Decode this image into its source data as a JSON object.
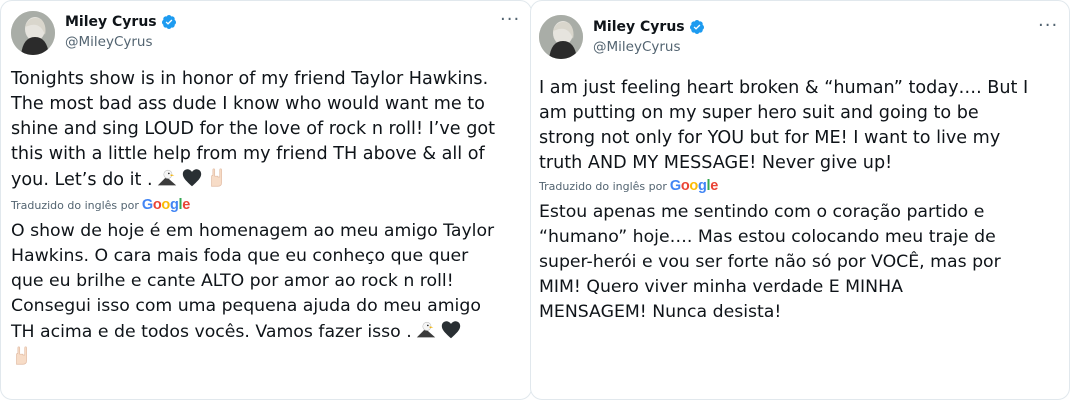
{
  "tweets": [
    {
      "author_name": "Miley Cyrus",
      "author_handle": "@MileyCyrus",
      "more_label": "···",
      "text_en": "Tonights show is in honor of my friend Taylor Hawkins.\nThe most bad ass dude I know who would want me to\nshine and sing LOUD for the love of rock n roll! I’ve got\nthis with a little help from my friend TH above & all of\nyou. Let’s do it .",
      "translated_label": "Traduzido do inglês por",
      "google_label": "Google",
      "text_pt": "O show de hoje é em homenagem ao meu amigo Taylor\nHawkins. O cara mais foda que eu conheço que quer\nque eu brilhe e cante ALTO por amor ao rock n roll!\nConsegui isso com uma pequena ajuda do meu amigo\nTH acima e de todos vocês. Vamos fazer isso ."
    },
    {
      "author_name": "Miley Cyrus",
      "author_handle": "@MileyCyrus",
      "more_label": "···",
      "text_en": "I am just feeling heart broken & “human” today…. But I\nam putting on my super hero suit and going to be\nstrong not only for YOU but for ME! I want to live my\ntruth AND MY MESSAGE! Never give up!",
      "translated_label": "Traduzido do inglês por",
      "google_label": "Google",
      "text_pt": "Estou apenas me sentindo com o coração partido e\n“humano” hoje…. Mas estou colocando meu traje de\nsuper-herói e vou ser forte não só por VOCÊ, mas por\nMIM! Quero viver minha verdade E MINHA\nMENSAGEM! Nunca desista!"
    }
  ],
  "colors": {
    "verified": "#1d9bf0",
    "secondary_text": "#536471",
    "text": "#0f1419"
  },
  "icons": [
    "verified-badge-icon",
    "eagle-emoji-icon",
    "black-heart-emoji-icon",
    "rock-hand-emoji-icon",
    "more-options-icon"
  ]
}
